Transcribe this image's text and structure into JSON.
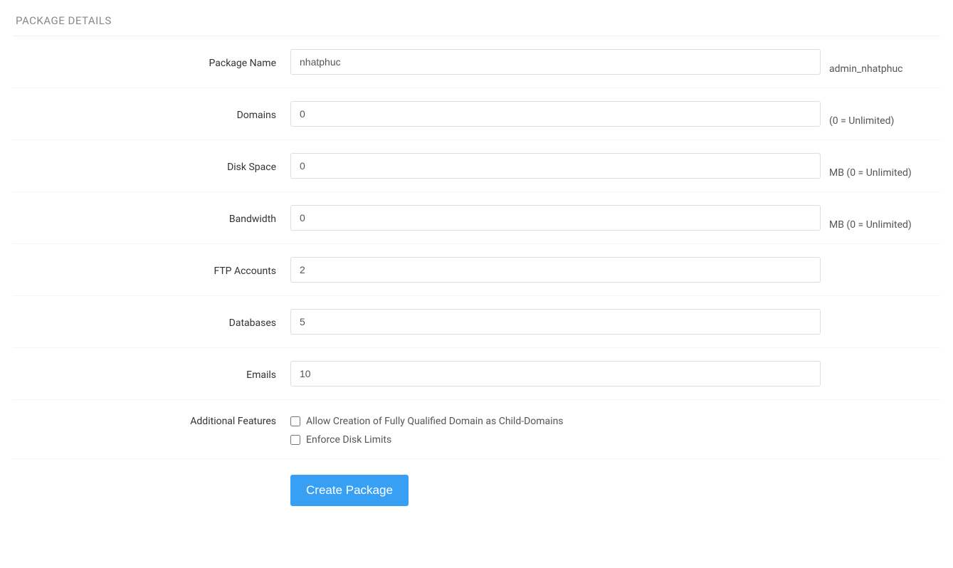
{
  "section": {
    "title": "PACKAGE DETAILS"
  },
  "fields": {
    "package_name": {
      "label": "Package Name",
      "value": "nhatphuc",
      "hint": "admin_nhatphuc"
    },
    "domains": {
      "label": "Domains",
      "value": "0",
      "hint": "(0 = Unlimited)"
    },
    "disk_space": {
      "label": "Disk Space",
      "value": "0",
      "hint": "MB (0 = Unlimited)"
    },
    "bandwidth": {
      "label": "Bandwidth",
      "value": "0",
      "hint": "MB (0 = Unlimited)"
    },
    "ftp_accounts": {
      "label": "FTP Accounts",
      "value": "2"
    },
    "databases": {
      "label": "Databases",
      "value": "5"
    },
    "emails": {
      "label": "Emails",
      "value": "10"
    },
    "additional": {
      "label": "Additional Features",
      "options": {
        "fqdn": "Allow Creation of Fully Qualified Domain as Child-Domains",
        "disk": "Enforce Disk Limits"
      }
    }
  },
  "actions": {
    "submit_label": "Create Package"
  }
}
